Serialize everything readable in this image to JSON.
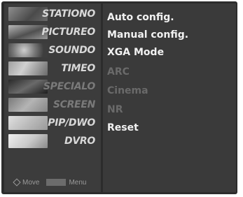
{
  "sidebar": {
    "items": [
      {
        "label": "STATIONO",
        "icon": "station-icon",
        "dim": false
      },
      {
        "label": "PICTUREO",
        "icon": "picture-icon",
        "dim": false
      },
      {
        "label": "SOUNDO",
        "icon": "sound-icon",
        "dim": false
      },
      {
        "label": "TIMEO",
        "icon": "time-icon",
        "dim": false
      },
      {
        "label": "SPECIALO",
        "icon": "special-icon",
        "dim": true
      },
      {
        "label": "SCREEN",
        "icon": "screen-icon",
        "dim": true
      },
      {
        "label": "PIP/DWO",
        "icon": "pip-icon",
        "dim": false
      },
      {
        "label": "DVRO",
        "icon": "dvr-icon",
        "dim": false
      }
    ],
    "selected_index": 0
  },
  "submenu": {
    "items": [
      {
        "label": "Auto config.",
        "enabled": true
      },
      {
        "label": "Manual config.",
        "enabled": true
      },
      {
        "label": "XGA Mode",
        "enabled": true
      },
      {
        "label": "ARC",
        "enabled": false
      },
      {
        "label": "Cinema",
        "enabled": false
      },
      {
        "label": "NR",
        "enabled": false
      },
      {
        "label": "Reset",
        "enabled": true
      }
    ]
  },
  "footer": {
    "move_label": "Move",
    "menu_label": "Menu"
  }
}
